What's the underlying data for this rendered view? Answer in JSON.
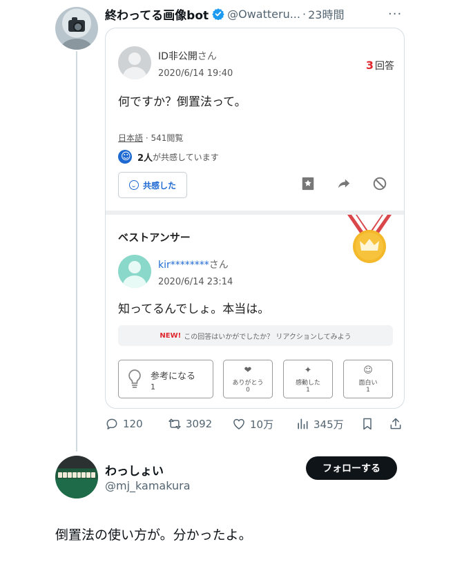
{
  "tweet": {
    "author_name": "終わってる画像bot",
    "handle": "@Owatteru...",
    "separator": "·",
    "time": "23時間",
    "more": "···",
    "icons": {
      "verified": "verified-badge-icon",
      "more": "more-dots-icon"
    }
  },
  "card": {
    "question": {
      "user": "ID非公開",
      "user_suffix": "さん",
      "date": "2020/6/14 19:40",
      "answer_count": "3",
      "answer_suffix": "回答",
      "text": "何ですか？倒置法って。",
      "language": "日本語",
      "views": "· 541閲覧",
      "empathy_count": "2人",
      "empathy_suffix": "が共感しています",
      "empathy_button": "共感した"
    },
    "best_answer": {
      "title": "ベストアンサー",
      "user": "kir********",
      "user_suffix": "さん",
      "date": "2020/6/14 23:14",
      "text": "知ってるんでしょ。本当は。",
      "banner_new": "NEW!",
      "banner_text": "この回答はいかがでしたか？ リアクションしてみよう",
      "reactions": [
        {
          "label": "参考になる",
          "count": "1",
          "icon": "lightbulb-icon"
        },
        {
          "label": "ありがとう",
          "count": "0",
          "icon": "heart-icon"
        },
        {
          "label": "感動した",
          "count": "1",
          "icon": "sparkle-icon"
        },
        {
          "label": "面白い",
          "count": "1",
          "icon": "smile-icon"
        }
      ]
    }
  },
  "actions": {
    "replies": "120",
    "retweets": "3092",
    "likes": "10万",
    "views": "345万"
  },
  "reply": {
    "name": "わっしょい",
    "handle": "@mj_kamakura",
    "follow_label": "フォローする",
    "text": "倒置法の使い方が。分かったよ。"
  },
  "colors": {
    "text_primary": "#0f1419",
    "text_secondary": "#536471",
    "chiebukuro_blue": "#1e69d2",
    "accent_red": "#e0272d",
    "verified_blue": "#1d9bf0"
  }
}
